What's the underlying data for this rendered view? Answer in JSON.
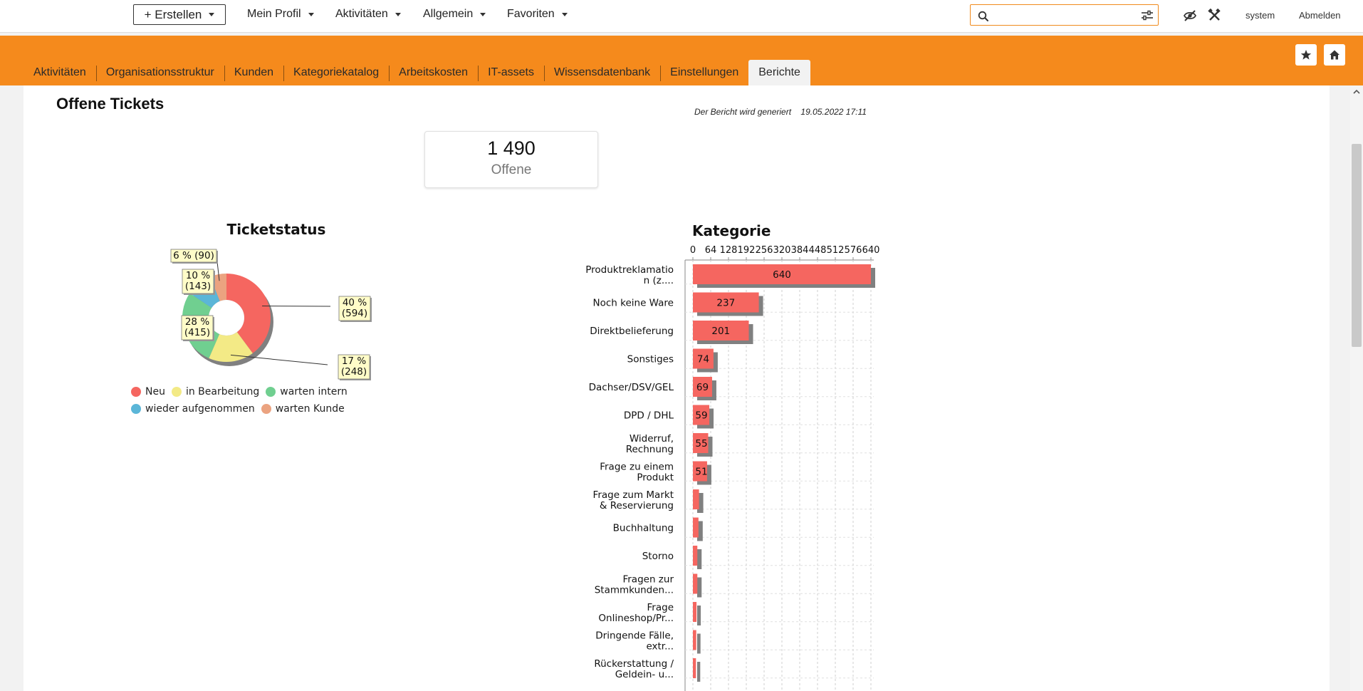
{
  "topbar": {
    "create_label": "+ Erstellen",
    "menus": [
      "Mein Profil",
      "Aktivitäten",
      "Allgemein",
      "Favoriten"
    ],
    "search": {
      "value": "",
      "placeholder": ""
    },
    "user": "system",
    "logout": "Abmelden"
  },
  "tabs": [
    {
      "label": "Aktivitäten",
      "active": false
    },
    {
      "label": "Organisationsstruktur",
      "active": false
    },
    {
      "label": "Kunden",
      "active": false
    },
    {
      "label": "Kategoriekatalog",
      "active": false
    },
    {
      "label": "Arbeitskosten",
      "active": false
    },
    {
      "label": "IT-assets",
      "active": false
    },
    {
      "label": "Wissensdatenbank",
      "active": false
    },
    {
      "label": "Einstellungen",
      "active": false
    },
    {
      "label": "Berichte",
      "active": true
    }
  ],
  "report": {
    "title": "Offene Tickets",
    "generated_label": "Der Bericht wird generiert",
    "generated_at": "19.05.2022 17:11",
    "kpi": {
      "value": "1 490",
      "label": "Offene"
    }
  },
  "colors": {
    "brand_orange": "#f58a1c",
    "bar_red": "#f56660",
    "shadow": "#808080"
  },
  "chart_data": [
    {
      "type": "pie",
      "title": "Ticketstatus",
      "slices": [
        {
          "name": "Neu",
          "value": 594,
          "label": "40 %\n(594)",
          "color": "#f56660"
        },
        {
          "name": "in Bearbeitung",
          "value": 248,
          "label": "17 %\n(248)",
          "color": "#f3ea86"
        },
        {
          "name": "warten intern",
          "value": 415,
          "label": "28 %\n(415)",
          "color": "#70cf90"
        },
        {
          "name": "wieder aufgenommen",
          "value": 143,
          "label": "10 %\n(143)",
          "color": "#5bb6d8"
        },
        {
          "name": "warten Kunde",
          "value": 90,
          "label": "6 % (90)",
          "color": "#eba380"
        }
      ],
      "legend": "bottom"
    },
    {
      "type": "bar",
      "orientation": "horizontal",
      "title": "Kategorie",
      "xlim": [
        0,
        640
      ],
      "ticks": [
        "0",
        "64",
        "128",
        "192",
        "256",
        "320",
        "384",
        "448",
        "512",
        "576",
        "640"
      ],
      "grid": true,
      "categories": [
        "Produktreklamatio\nn (z....",
        "Noch keine Ware",
        "Direktbelieferung",
        "Sonstiges",
        "Dachser/DSV/GEL",
        "DPD / DHL",
        "Widerruf,\nRechnung",
        "Frage zu einem\nProdukt",
        "Frage zum Markt\n& Reservierung",
        "Buchhaltung",
        "Storno",
        "Fragen zur\nStammkunden...",
        "Frage\nOnlineshop/Pr...",
        "Dringende Fälle,\nextr...",
        "Rückerstattung /\nGeldein- u..."
      ],
      "values": [
        640,
        237,
        201,
        74,
        69,
        59,
        55,
        51,
        22,
        20,
        16,
        16,
        13,
        12,
        11
      ],
      "value_labels": [
        "640",
        "237",
        "201",
        "74",
        "69",
        "59",
        "55",
        "51",
        "",
        "",
        "",
        "",
        "",
        "",
        ""
      ]
    }
  ]
}
